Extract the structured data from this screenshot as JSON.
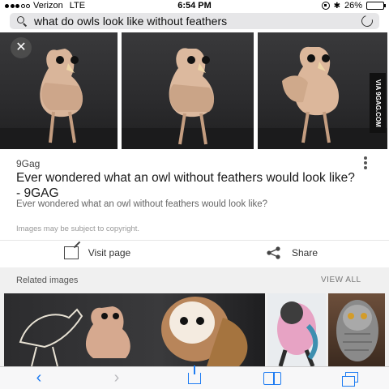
{
  "status_bar": {
    "carrier": "Verizon",
    "network": "LTE",
    "time": "6:54 PM",
    "battery": "26%",
    "battery_level": 0.26,
    "signal_dots": 5,
    "signal_filled": 3
  },
  "search": {
    "query": "what do owls look like without feathers"
  },
  "result": {
    "source": "9Gag",
    "title": "Ever wondered what an owl without feathers would look like? - 9GAG",
    "description": "Ever wondered what an owl without feathers would look like?",
    "copyright": "Images may be subject to copyright.",
    "watermark": "VIA 9GAG.COM"
  },
  "actions": {
    "visit": "Visit page",
    "share": "Share"
  },
  "related": {
    "header": "Related images",
    "view_all": "VIEW ALL"
  },
  "colors": {
    "accent": "#1e7cf2",
    "search_bg": "#e6e6e8",
    "photo_bg": "#333335"
  },
  "icons": [
    "search-icon",
    "reload-icon",
    "close-icon",
    "more-icon",
    "visit-page-icon",
    "share-icon",
    "back-icon",
    "forward-icon",
    "share-sheet-icon",
    "bookmarks-icon",
    "tabs-icon"
  ]
}
